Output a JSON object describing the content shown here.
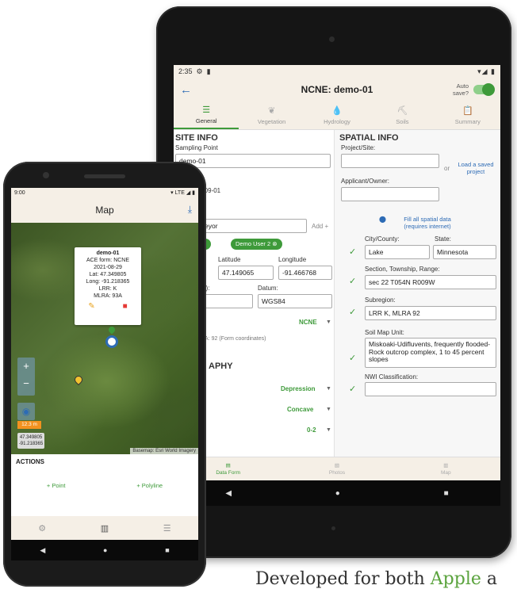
{
  "tablet": {
    "status_time": "2:35",
    "status_icons": "▾◢ ▮",
    "back": "←",
    "title": "NCNE: demo-01",
    "autosave_line1": "Auto",
    "autosave_line2": "save?",
    "tabs": [
      {
        "label": "General",
        "icon": "☰"
      },
      {
        "label": "Vegetation",
        "icon": "❦"
      },
      {
        "label": "Hydrology",
        "icon": "💧"
      },
      {
        "label": "Soils",
        "icon": "⛏"
      },
      {
        "label": "Summary",
        "icon": "📋"
      }
    ],
    "site_info": {
      "heading": "SITE INFO",
      "sampling_point_label": "Sampling Point",
      "sampling_point_value": "demo-01",
      "date_value": "-09-01",
      "surveyor_value": "eyor",
      "add_label": "Add +",
      "chip1": "er ⊗",
      "chip2": "Demo User 2 ⊗",
      "latitude_label": "Latitude",
      "latitude_value": "47.149065",
      "longitude_label": "Longitude",
      "longitude_value": "-91.466768",
      "partial_label": "m):",
      "datum_label": "Datum:",
      "datum_value": "WGS84",
      "region_value": "NCNE",
      "mlra_note": "RA: 92 (Form coordinates)",
      "topo_heading": "APHY",
      "landform_value": "Depression",
      "relief_value": "Concave",
      "slope_value": "0-2"
    },
    "spatial_info": {
      "heading": "SPATIAL INFO",
      "project_label": "Project/Site:",
      "project_value": "",
      "or": "or",
      "load_project": "Load a saved project",
      "applicant_label": "Applicant/Owner:",
      "applicant_value": "",
      "fill_spatial": "Fill all spatial data (requires internet)",
      "city_label": "City/County:",
      "city_value": "Lake",
      "state_label": "State:",
      "state_value": "Minnesota",
      "str_label": "Section, Township, Range:",
      "str_value": "sec 22 T054N R009W",
      "subregion_label": "Subregion:",
      "subregion_value": "LRR K, MLRA 92",
      "soil_label": "Soil Map Unit:",
      "soil_value": "Miskoaki-Udifluvents, frequently flooded-Rock outcrop complex, 1 to 45 percent slopes",
      "nwi_label": "NWI Classification:",
      "nwi_value": ""
    },
    "bottom_nav": [
      {
        "label": "Data Form",
        "icon": "▤"
      },
      {
        "label": "Photos",
        "icon": "▧"
      },
      {
        "label": "Map",
        "icon": "▥"
      }
    ]
  },
  "phone": {
    "status_time": "9:00",
    "status_icons": "▾ LTE ◢ ▮",
    "title": "Map",
    "download_icon": "⤓",
    "popup": {
      "title": "demo-01",
      "form": "ACE form: NCNE",
      "date": "2021-08-29",
      "lat": "Lat: 47.349805",
      "long": "Long: -91.218365",
      "lrr": "LRR: K",
      "mlra": "MLRA: 93A"
    },
    "accuracy": "12.3 m",
    "coord_lat": "47.349805",
    "coord_long": "-91.218365",
    "attribution": "Basemap: Esri World Imagery",
    "actions_heading": "ACTIONS",
    "add_point": "+ Point",
    "add_polyline": "+ Polyline"
  },
  "caption": {
    "before": "Developed for both ",
    "apple": "Apple",
    "after": " a"
  },
  "colors": {
    "accent_green": "#3e9a3a",
    "link_blue": "#2d6bb5",
    "appbar": "#f5efe6"
  }
}
